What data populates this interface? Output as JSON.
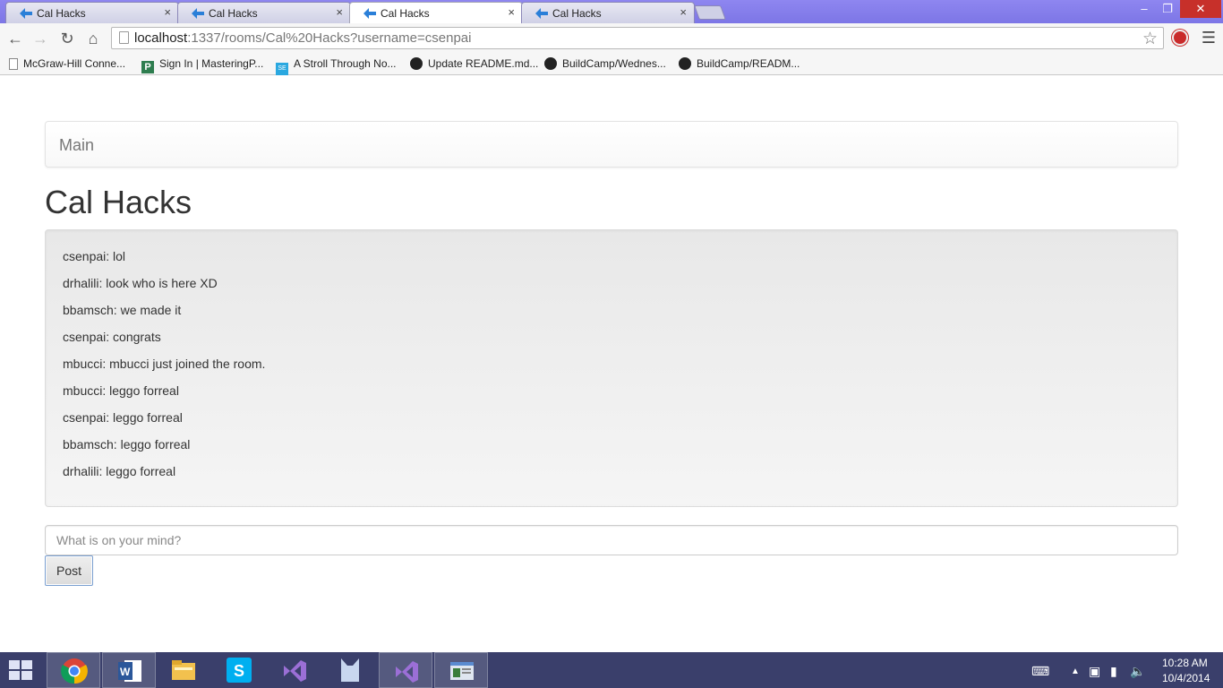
{
  "browser": {
    "tabs": [
      {
        "title": "Cal Hacks",
        "active": false
      },
      {
        "title": "Cal Hacks",
        "active": false
      },
      {
        "title": "Cal Hacks",
        "active": true
      },
      {
        "title": "Cal Hacks",
        "active": false
      }
    ],
    "close_glyph": "×",
    "address": {
      "host": "localhost",
      "rest": ":1337/rooms/Cal%20Hacks?username=csenpai"
    },
    "bookmarks": [
      {
        "label": "McGraw-Hill Conne...",
        "icon": "page-icon"
      },
      {
        "label": "Sign In | MasteringP...",
        "icon": "pearson-icon"
      },
      {
        "label": "A Stroll Through No...",
        "icon": "se-icon"
      },
      {
        "label": "Update README.md...",
        "icon": "github-icon"
      },
      {
        "label": "BuildCamp/Wednes...",
        "icon": "github-icon"
      },
      {
        "label": "BuildCamp/READM...",
        "icon": "github-icon"
      }
    ]
  },
  "page": {
    "navbar_brand": "Main",
    "room_title": "Cal Hacks",
    "messages": [
      "csenpai: lol",
      "drhalili: look who is here XD",
      "bbamsch: we made it",
      "csenpai: congrats",
      "mbucci: mbucci just joined the room.",
      "mbucci: leggo forreal",
      "csenpai: leggo forreal",
      "bbamsch: leggo forreal",
      "drhalili: leggo forreal"
    ],
    "input_placeholder": "What is on your mind?",
    "post_label": "Post"
  },
  "taskbar": {
    "apps": [
      "chrome-icon",
      "word-icon",
      "file-explorer-icon",
      "skype-icon",
      "visual-studio-icon",
      "app-icon",
      "visual-studio-icon",
      "window-app-icon"
    ],
    "time": "10:28 AM",
    "date": "10/4/2014"
  }
}
